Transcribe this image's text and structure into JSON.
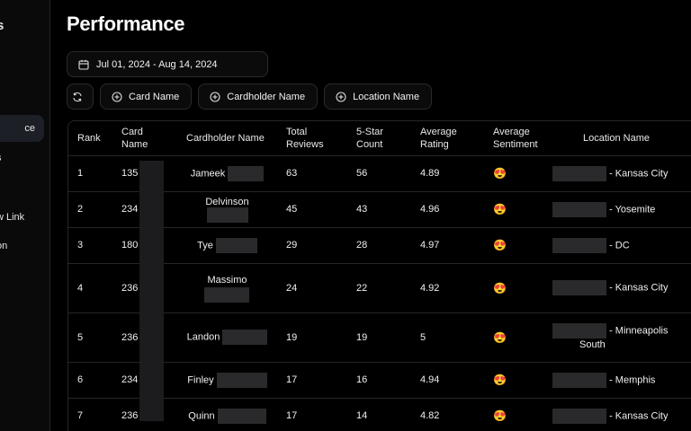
{
  "sidebar": {
    "items": [
      {
        "label": "s",
        "top": 0
      },
      {
        "label": "l",
        "top": 0
      },
      {
        "label": "ce",
        "top": 0
      },
      {
        "label": "s",
        "top": 0
      },
      {
        "label": "w Link",
        "top": 0
      },
      {
        "label": "on",
        "top": 0
      }
    ]
  },
  "page": {
    "title": "Performance"
  },
  "date_range": {
    "label": "Jul 01, 2024 - Aug 14, 2024"
  },
  "filters": {
    "card_name": "Card Name",
    "cardholder_name": "Cardholder Name",
    "location_name": "Location Name"
  },
  "table": {
    "headers": {
      "rank": "Rank",
      "card_name_1": "Card",
      "card_name_2": "Name",
      "cardholder": "Cardholder Name",
      "total_1": "Total",
      "total_2": "Reviews",
      "five_1": "5-Star",
      "five_2": "Count",
      "avg_rating_1": "Average",
      "avg_rating_2": "Rating",
      "avg_sent_1": "Average",
      "avg_sent_2": "Sentiment",
      "location": "Location Name"
    },
    "rows": [
      {
        "rank": "1",
        "card": "135",
        "holder": "Jameek",
        "total": "63",
        "five": "56",
        "rating": "4.89",
        "sentiment": "😍",
        "location": "- Kansas City"
      },
      {
        "rank": "2",
        "card": "234",
        "holder": "Delvinson",
        "total": "45",
        "five": "43",
        "rating": "4.96",
        "sentiment": "😍",
        "location": "- Yosemite"
      },
      {
        "rank": "3",
        "card": "180",
        "holder": "Tye",
        "total": "29",
        "five": "28",
        "rating": "4.97",
        "sentiment": "😍",
        "location": "- DC"
      },
      {
        "rank": "4",
        "card": "236",
        "holder": "Massimo",
        "total": "24",
        "five": "22",
        "rating": "4.92",
        "sentiment": "😍",
        "location": "- Kansas City"
      },
      {
        "rank": "5",
        "card": "236",
        "holder": "Landon",
        "total": "19",
        "five": "19",
        "rating": "5",
        "sentiment": "😍",
        "location": "- Minneapolis",
        "location_2": "South"
      },
      {
        "rank": "6",
        "card": "234",
        "holder": "Finley",
        "total": "17",
        "five": "16",
        "rating": "4.94",
        "sentiment": "😍",
        "location": "- Memphis"
      },
      {
        "rank": "7",
        "card": "236",
        "holder": "Quinn",
        "total": "17",
        "five": "14",
        "rating": "4.82",
        "sentiment": "😍",
        "location": "- Kansas City"
      }
    ]
  }
}
